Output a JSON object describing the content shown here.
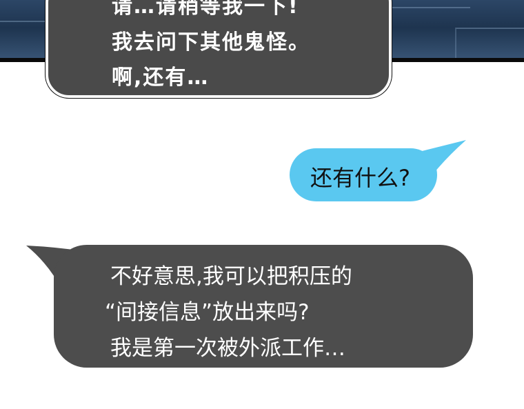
{
  "top_bubble": {
    "lines": [
      "请…请稍等我一下!",
      "我去问下其他鬼怪。",
      "啊,还有…"
    ]
  },
  "blue_bubble": {
    "text": "还有什么?",
    "color": "#5ac8f0"
  },
  "gray_bubble": {
    "lines": [
      "不好意思,我可以把积压的",
      "“间接信息”放出来吗?",
      "我是第一次被外派工作…"
    ],
    "color": "#4d4d4d"
  }
}
